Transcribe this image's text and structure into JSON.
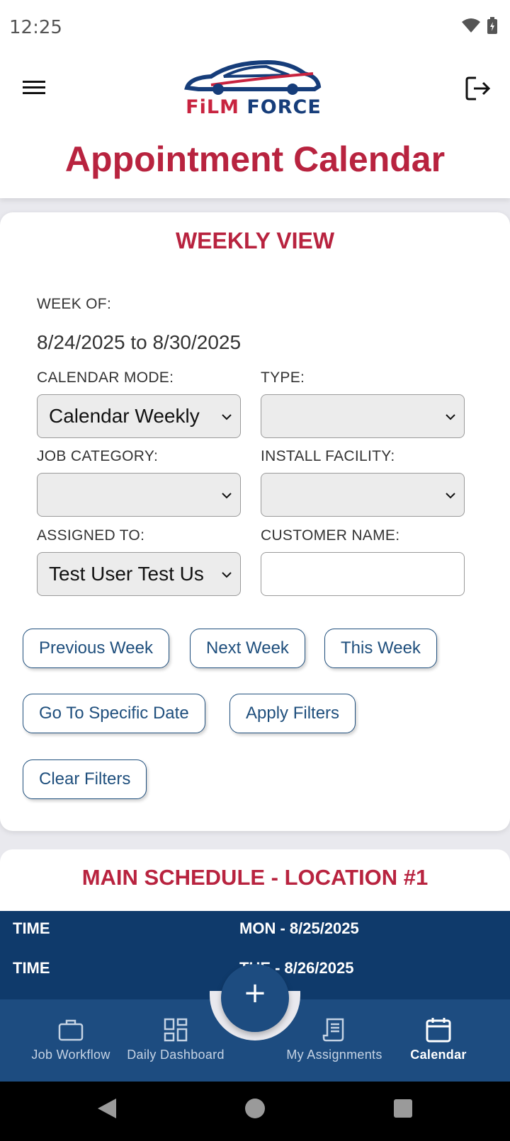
{
  "status": {
    "time": "12:25"
  },
  "header": {
    "logo_part1": "FiLM",
    "logo_part2": "FORCE",
    "title": "Appointment Calendar"
  },
  "weekly": {
    "title": "WEEKLY VIEW",
    "week_of_label": "WEEK OF:",
    "week_range": "8/24/2025 to 8/30/2025",
    "calendar_mode_label": "CALENDAR MODE:",
    "calendar_mode_value": "Calendar Weekly",
    "type_label": "TYPE:",
    "type_value": "",
    "job_category_label": "JOB CATEGORY:",
    "job_category_value": "",
    "install_facility_label": "INSTALL FACILITY:",
    "install_facility_value": "",
    "assigned_to_label": "ASSIGNED TO:",
    "assigned_to_value": "Test User Test Us",
    "customer_name_label": "CUSTOMER NAME:",
    "customer_name_value": ""
  },
  "buttons": {
    "previous_week": "Previous Week",
    "next_week": "Next Week",
    "this_week": "This Week",
    "go_to_date": "Go To Specific Date",
    "apply_filters": "Apply Filters",
    "clear_filters": "Clear Filters"
  },
  "schedule": {
    "title": "MAIN SCHEDULE - LOCATION #1",
    "rows": [
      {
        "time": "TIME",
        "day": "MON - 8/25/2025"
      },
      {
        "time": "TIME",
        "day": "TUE - 8/26/2025"
      }
    ]
  },
  "fab": {
    "label": "+"
  },
  "nav": [
    {
      "label": "Job Workflow",
      "icon": "briefcase-icon"
    },
    {
      "label": "Daily Dashboard",
      "icon": "dashboard-grid-icon"
    },
    {
      "label": "My Assignments",
      "icon": "assignments-scroll-icon"
    },
    {
      "label": "Calendar",
      "icon": "calendar-icon"
    }
  ],
  "colors": {
    "brand_red": "#b8233f",
    "brand_blue": "#1d4c80",
    "table_header": "#0f3a6b"
  }
}
